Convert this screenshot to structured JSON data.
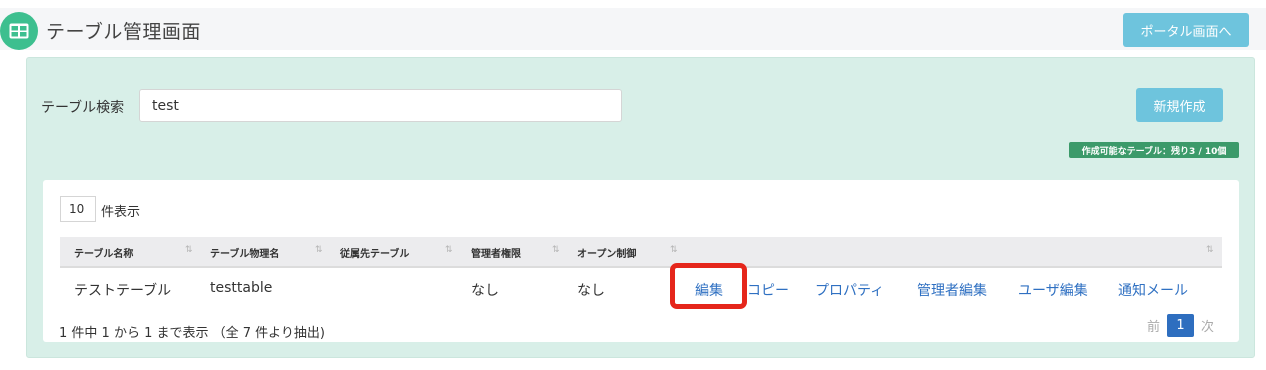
{
  "header": {
    "title": "テーブル管理画面",
    "portal_button": "ポータル画面へ",
    "icon": "table-icon"
  },
  "search": {
    "label": "テーブル検索",
    "value": "test"
  },
  "actions": {
    "new_button": "新規作成",
    "quota_badge": "作成可能なテーブル：残り3 / 10個"
  },
  "length": {
    "value": "10",
    "label": "件表示"
  },
  "table": {
    "columns": [
      "テーブル名称",
      "テーブル物理名",
      "従属先テーブル",
      "管理者権限",
      "オープン制御",
      ""
    ],
    "sort_icon": "⇅",
    "rows": [
      {
        "name": "テストテーブル",
        "physical_name": "testtable",
        "parent": "",
        "admin": "なし",
        "open_control": "なし",
        "links": [
          "編集",
          "コピー",
          "プロパティ",
          "管理者編集",
          "ユーザ編集",
          "通知メール"
        ]
      }
    ]
  },
  "footer": {
    "info": "1 件中 1 から 1 まで表示 （全 7 件より抽出)",
    "prev": "前",
    "current_page": "1",
    "next": "次"
  },
  "colors": {
    "accent": "#6ec4dd",
    "panel": "#d8efe8",
    "link": "#2f70c2",
    "highlight": "#e5261b",
    "badge": "#3c9a6a"
  }
}
